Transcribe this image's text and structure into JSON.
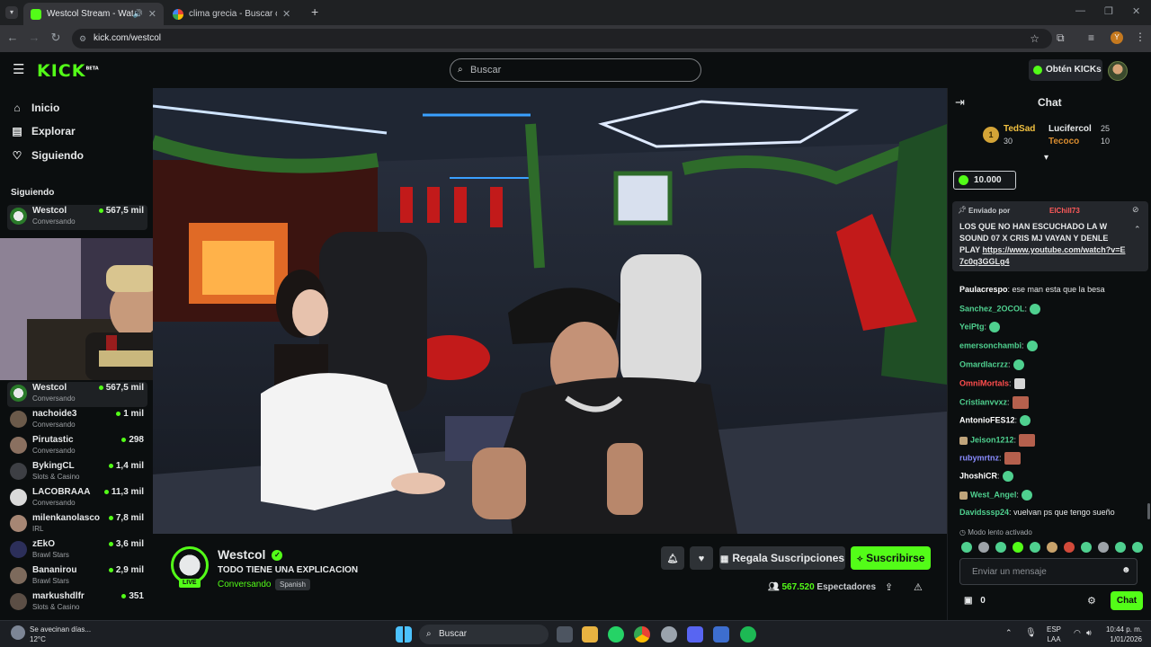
{
  "browser": {
    "tabs": [
      {
        "title": "Westcol Stream - Watch Live",
        "active": true
      },
      {
        "title": "clima grecia - Buscar con Google",
        "active": false
      }
    ],
    "url": "kick.com/westcol",
    "profile_initial": "Y"
  },
  "header": {
    "logo": "KICK",
    "logo_badge": "BETA",
    "search_placeholder": "Buscar",
    "kicks_button": "Obtén KICKs"
  },
  "sidebar": {
    "nav": [
      {
        "label": "Inicio",
        "icon": "home-icon"
      },
      {
        "label": "Explorar",
        "icon": "compass-icon"
      },
      {
        "label": "Siguiendo",
        "icon": "heart-icon"
      }
    ],
    "following_title": "Siguiendo",
    "following": [
      {
        "name": "Westcol",
        "category": "Conversando",
        "viewers": "567,5 mil"
      }
    ],
    "recommended": [
      {
        "name": "Westcol",
        "category": "Conversando",
        "viewers": "567,5 mil"
      },
      {
        "name": "nachoide3",
        "category": "Conversando",
        "viewers": "1 mil"
      },
      {
        "name": "Pirutastic",
        "category": "Conversando",
        "viewers": "298"
      },
      {
        "name": "BykingCL",
        "category": "Slots & Casino",
        "viewers": "1,4 mil"
      },
      {
        "name": "LACOBRAAA",
        "category": "Conversando",
        "viewers": "11,3 mil"
      },
      {
        "name": "milenkanolasco",
        "category": "IRL",
        "viewers": "7,8 mil"
      },
      {
        "name": "zEkO",
        "category": "Brawl Stars",
        "viewers": "3,6 mil"
      },
      {
        "name": "Bananirou",
        "category": "Brawl Stars",
        "viewers": "2,9 mil"
      },
      {
        "name": "markushdlfr",
        "category": "Slots & Casino",
        "viewers": "351"
      }
    ]
  },
  "stream": {
    "channel": "Westcol",
    "title": "TODO TIENE UNA EXPLICACION",
    "category": "Conversando",
    "language": "Spanish",
    "live_badge": "LIVE",
    "gift_button": "Regala Suscripciones",
    "subscribe_button": "Suscribirse",
    "viewers_count": "567.520",
    "viewers_label": "Espectadores"
  },
  "chat": {
    "title": "Chat",
    "leaderboard": [
      {
        "rank": "1",
        "name": "TedSad",
        "value": "30"
      },
      {
        "name": "Lucifercol",
        "value": "25"
      },
      {
        "name": "Tecoco",
        "value": "10"
      }
    ],
    "kicks_amount": "10.000",
    "pinned": {
      "prefix": "Enviado por",
      "sender": "ElChill73",
      "text": "LOS QUE NO HAN ESCUCHADO LA W SOUND 07 X CRIS MJ VAYAN Y DENLE PLAY",
      "link": "https://www.youtube.com/watch?v=E7c0q3GGLg4"
    },
    "messages": [
      {
        "user": "Paulacrespo",
        "text": "ese man esta que la besa",
        "color": "#ffffff",
        "emote": ""
      },
      {
        "user": "Sanchez_2OCOL",
        "text": "",
        "color": "#4fd08f",
        "emote": "green"
      },
      {
        "user": "YeiPtg",
        "text": "",
        "color": "#4fd08f",
        "emote": "green"
      },
      {
        "user": "emersonchambi",
        "text": "",
        "color": "#4fd08f",
        "emote": "green"
      },
      {
        "user": "Omardlacrzz",
        "text": "",
        "color": "#4fd08f",
        "emote": "green"
      },
      {
        "user": "OmniMortals",
        "text": "",
        "color": "#ff4d4d",
        "emote": "gray"
      },
      {
        "user": "Cristianvvxz",
        "text": "",
        "color": "#4fd08f",
        "emote": "img"
      },
      {
        "user": "AntonioFES12",
        "text": "",
        "color": "#ffffff",
        "emote": "green"
      },
      {
        "user": "Jeison1212",
        "text": "",
        "color": "#4fd08f",
        "emote": "img"
      },
      {
        "user": "rubymrtnz",
        "text": "",
        "color": "#8a8cff",
        "emote": "img"
      },
      {
        "user": "JhoshiCR",
        "text": "",
        "color": "#ffffff",
        "emote": "green"
      },
      {
        "user": "West_Angel",
        "text": "",
        "color": "#4fd08f",
        "emote": "green"
      },
      {
        "user": "Davidsssp24",
        "text": "vuelvan ps que tengo sueño",
        "color": "#4fd08f",
        "emote": ""
      }
    ],
    "slow_mode": "Modo lento activado",
    "input_placeholder": "Enviar un mensaje",
    "points": "0",
    "send_button": "Chat"
  },
  "taskbar": {
    "weather_text": "Se avecinan días...",
    "weather_temp": "12°C",
    "search": "Buscar",
    "lang": "ESP",
    "lang2": "LAA",
    "time": "10:44 p. m.",
    "date": "1/01/2026"
  }
}
